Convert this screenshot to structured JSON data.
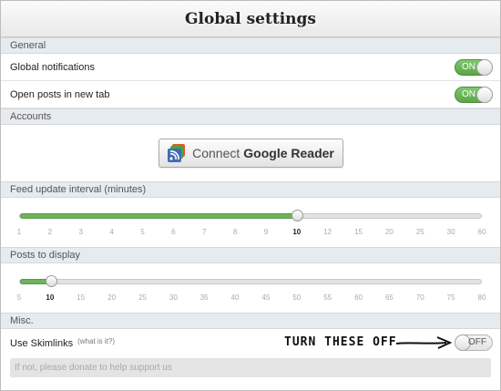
{
  "title": "Global settings",
  "general": {
    "header": "General",
    "rows": [
      {
        "label": "Global notifications",
        "toggle": "ON"
      },
      {
        "label": "Open posts in new tab",
        "toggle": "ON"
      }
    ]
  },
  "accounts": {
    "header": "Accounts",
    "connect_prefix": "Connect",
    "connect_bold": "Google Reader"
  },
  "feed_interval": {
    "header": "Feed update interval (minutes)",
    "ticks": [
      "1",
      "2",
      "3",
      "4",
      "5",
      "6",
      "7",
      "8",
      "9",
      "10",
      "12",
      "15",
      "20",
      "25",
      "30",
      "60"
    ],
    "selected": "10",
    "selected_index": 9
  },
  "posts": {
    "header": "Posts to display",
    "ticks": [
      "5",
      "10",
      "15",
      "20",
      "25",
      "30",
      "35",
      "40",
      "45",
      "50",
      "55",
      "60",
      "65",
      "70",
      "75",
      "80"
    ],
    "selected": "10",
    "selected_index": 1
  },
  "misc": {
    "header": "Misc.",
    "skimlinks_label": "Use Skimlinks",
    "what_is_it": "(what is it?)",
    "annotation": "TURN THESE OFF",
    "toggle": "OFF",
    "donate": "If not, please donate to help support us"
  },
  "colors": {
    "accent_green": "#6fb35c",
    "section_header_bg": "#e6ebf0"
  }
}
